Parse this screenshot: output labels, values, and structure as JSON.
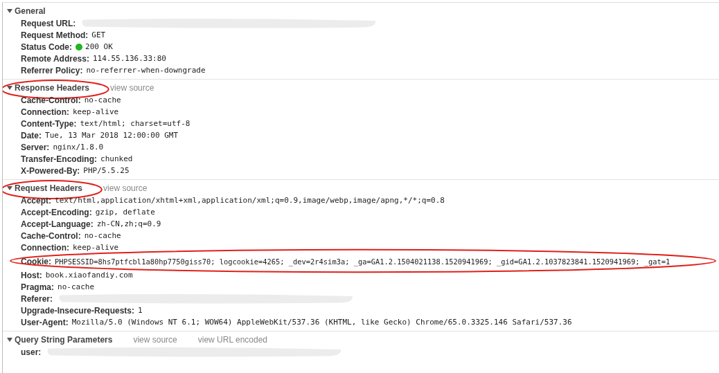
{
  "sections": [
    {
      "title": "General",
      "expanded": true,
      "rows": [
        {
          "name": "Request URL:",
          "redacted": true
        },
        {
          "name": "Request Method:",
          "value": "GET"
        },
        {
          "name": "Status Code:",
          "value": "200 OK",
          "color": "#22b422"
        },
        {
          "name": "Remote Address:",
          "value": "114.55.136.33:80"
        },
        {
          "name": "Referrer Policy:",
          "value": "no-referrer-when-downgrade"
        }
      ]
    },
    {
      "title": "Response Headers",
      "expanded": true,
      "highlighted": true,
      "links": [
        "view source"
      ],
      "rows": [
        {
          "name": "Cache-Control:",
          "value": "no-cache"
        },
        {
          "name": "Connection:",
          "value": "keep-alive"
        },
        {
          "name": "Content-Type:",
          "value": "text/html; charset=utf-8"
        },
        {
          "name": "Date:",
          "value": "Tue, 13 Mar 2018 12:00:00 GMT"
        },
        {
          "name": "Server:",
          "value": "nginx/1.8.0"
        },
        {
          "name": "Transfer-Encoding:",
          "value": "chunked"
        },
        {
          "name": "X-Powered-By:",
          "value": "PHP/5.5.25"
        }
      ]
    },
    {
      "title": "Request Headers",
      "expanded": true,
      "highlighted": true,
      "links": [
        "view source"
      ],
      "rows": [
        {
          "name": "Accept:",
          "value": "text/html,application/xhtml+xml,application/xml;q=0.9,image/webp,image/apng,*/*;q=0.8"
        },
        {
          "name": "Accept-Encoding:",
          "value": "gzip, deflate"
        },
        {
          "name": "Accept-Language:",
          "value": "zh-CN,zh;q=0.9"
        },
        {
          "name": "Cache-Control:",
          "value": "no-cache"
        },
        {
          "name": "Connection:",
          "value": "keep-alive"
        },
        {
          "name": "Cookie:",
          "value": "PHPSESSID=8hs7ptfcbl1a80hp7750giss70; logcookie=4265; _dev=2r4sim3a; _ga=GA1.2.1504021138.1520941969; _gid=GA1.2.1037823841.1520941969; _gat=1",
          "highlighted": true
        },
        {
          "name": "Host:",
          "value": "book.xiaofandiy.com"
        },
        {
          "name": "Pragma:",
          "value": "no-cache"
        },
        {
          "name": "Referer:",
          "redacted": true
        },
        {
          "name": "Upgrade-Insecure-Requests:",
          "value": "1"
        },
        {
          "name": "User-Agent:",
          "value": "Mozilla/5.0 (Windows NT 6.1; WOW64) AppleWebKit/537.36 (KHTML, like Gecko) Chrome/65.0.3325.146 Safari/537.36"
        }
      ]
    },
    {
      "title": "Query String Parameters",
      "expanded": true,
      "links": [
        "view source",
        "view URL encoded"
      ],
      "rows": [
        {
          "name": "user:",
          "redacted": true
        }
      ]
    }
  ]
}
